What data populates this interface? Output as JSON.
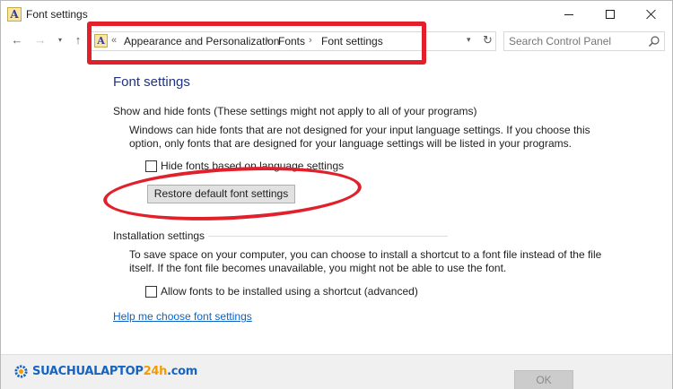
{
  "window": {
    "title": "Font settings",
    "title_icon_glyph": "A"
  },
  "nav": {
    "back_icon": "←",
    "forward_icon": "→",
    "recent_icon": "▾",
    "up_icon": "↑",
    "address_icon_glyph": "A",
    "overflow": "«",
    "breadcrumb": [
      "Appearance and Personalization",
      "Fonts",
      "Font settings"
    ],
    "separator": "›",
    "dropdown_icon": "▾",
    "refresh_icon": "↻",
    "search_placeholder": "Search Control Panel"
  },
  "main": {
    "page_title": "Font settings",
    "show_hide": {
      "heading": "Show and hide fonts (These settings might not apply to all of your programs)",
      "description_line1": "Windows can hide fonts that are not designed for your input language settings. If you choose this",
      "description_line2": "option, only fonts that are designed for your language settings will be listed in your programs.",
      "checkbox_label": "Hide fonts based on language settings",
      "checkbox_checked": false,
      "restore_button": "Restore default font settings"
    },
    "installation": {
      "heading": "Installation settings",
      "description_line1": "To save space on your computer, you can choose to install a shortcut to a font file instead of the file",
      "description_line2": "itself. If the font file becomes unavailable, you might not be able to use the font.",
      "checkbox_label": "Allow fonts to be installed using a shortcut (advanced)",
      "checkbox_checked": false
    },
    "help_link": "Help me choose font settings"
  },
  "footer": {
    "brand_main": "SUACHUALAPTOP",
    "brand_accent": "24h",
    "brand_suffix": ".com",
    "ok_button": "OK"
  },
  "colors": {
    "annotation": "#e1202c",
    "title_blue": "#1e3287",
    "link": "#0b63c5",
    "brand_blue": "#1565c0",
    "brand_orange": "#f59a00"
  }
}
